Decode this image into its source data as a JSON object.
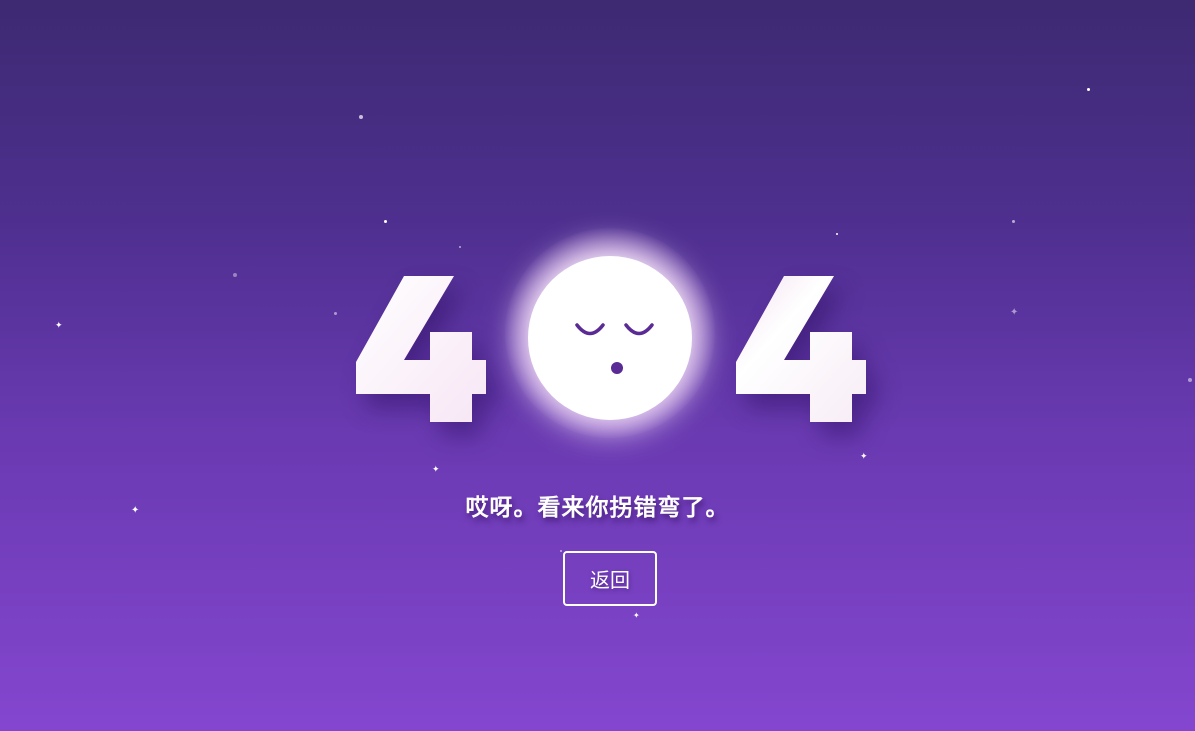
{
  "error": {
    "code_left_digit": "4",
    "code_right_digit": "4",
    "message": "哎呀。看来你拐错弯了。",
    "back_label": "返回"
  },
  "colors": {
    "background_top": "#3d2a72",
    "background_bottom": "#8446cf",
    "face_color": "#5a2a95",
    "text": "#ffffff"
  },
  "icons": {
    "moon": "sleeping-moon-face-icon",
    "stars": "star-sparkle-icon"
  }
}
